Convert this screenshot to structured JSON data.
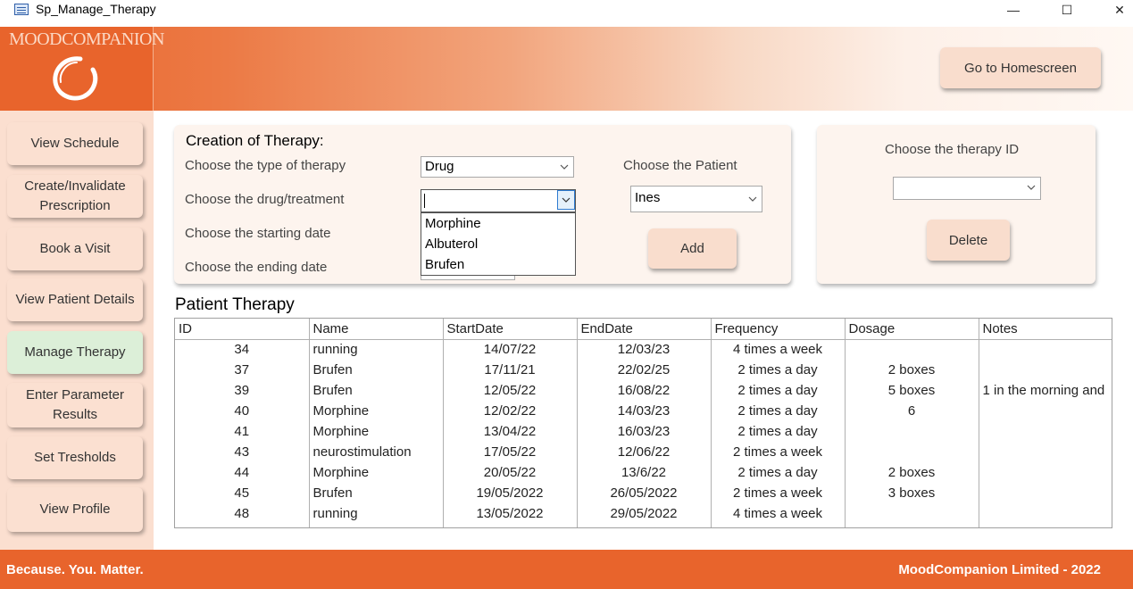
{
  "window": {
    "title": "Sp_Manage_Therapy",
    "minimize": "—",
    "maximize": "☐",
    "close": "✕"
  },
  "header": {
    "logo_text": "MOODCOMPANION",
    "home_button": "Go to Homescreen"
  },
  "sidebar": {
    "items": [
      {
        "label": "View Schedule"
      },
      {
        "label": "Create/Invalidate Prescription"
      },
      {
        "label": "Book a Visit"
      },
      {
        "label": "View Patient Details"
      },
      {
        "label": "Manage Therapy"
      },
      {
        "label": "Enter Parameter Results"
      },
      {
        "label": "Set Tresholds"
      },
      {
        "label": "View Profile"
      }
    ]
  },
  "creation": {
    "title": "Creation of Therapy:",
    "type_label": "Choose the type of therapy",
    "type_value": "Drug",
    "drug_label": "Choose the drug/treatment",
    "drug_value": "",
    "drug_options": [
      "Morphine",
      "Albuterol",
      "Brufen"
    ],
    "start_label": "Choose the starting date",
    "end_label": "Choose the ending date",
    "patient_label": "Choose the Patient",
    "patient_value": "Ines",
    "add_button": "Add"
  },
  "delete_panel": {
    "label": "Choose the therapy ID",
    "id_value": "",
    "delete_button": "Delete"
  },
  "patient_therapy": {
    "title": "Patient Therapy",
    "columns": [
      "ID",
      "Name",
      "StartDate",
      "EndDate",
      "Frequency",
      "Dosage",
      "Notes"
    ],
    "rows": [
      [
        "34",
        "running",
        "14/07/22",
        "12/03/23",
        "4 times a week",
        "",
        ""
      ],
      [
        "37",
        "Brufen",
        "17/11/21",
        "22/02/25",
        "2 times a day",
        "2 boxes",
        ""
      ],
      [
        "39",
        "Brufen",
        "12/05/22",
        "16/08/22",
        "2 times a day",
        "5 boxes",
        "1 in the morning and"
      ],
      [
        "40",
        "Morphine",
        "12/02/22",
        "14/03/23",
        "2 times a day",
        "6",
        ""
      ],
      [
        "41",
        "Morphine",
        "13/04/22",
        "16/03/23",
        "2 times a day",
        "",
        ""
      ],
      [
        "43",
        "neurostimulation",
        "17/05/22",
        "12/06/22",
        "2 times a week",
        "",
        ""
      ],
      [
        "44",
        "Morphine",
        "20/05/22",
        "13/6/22",
        "2 times a day",
        "2 boxes",
        ""
      ],
      [
        "45",
        "Brufen",
        "19/05/2022",
        "26/05/2022",
        "2 times a week",
        "3 boxes",
        ""
      ],
      [
        "48",
        "running",
        "13/05/2022",
        "29/05/2022",
        "4 times a week",
        "",
        ""
      ]
    ]
  },
  "footer": {
    "slogan": "Because. You. Matter.",
    "copyright": "MoodCompanion Limited - 2022"
  },
  "colors": {
    "brand_orange": "#e8642c",
    "sidebar_bg": "#fbdfd0",
    "active_nav": "#dcefd8",
    "button_bg": "#f9ddcd"
  }
}
